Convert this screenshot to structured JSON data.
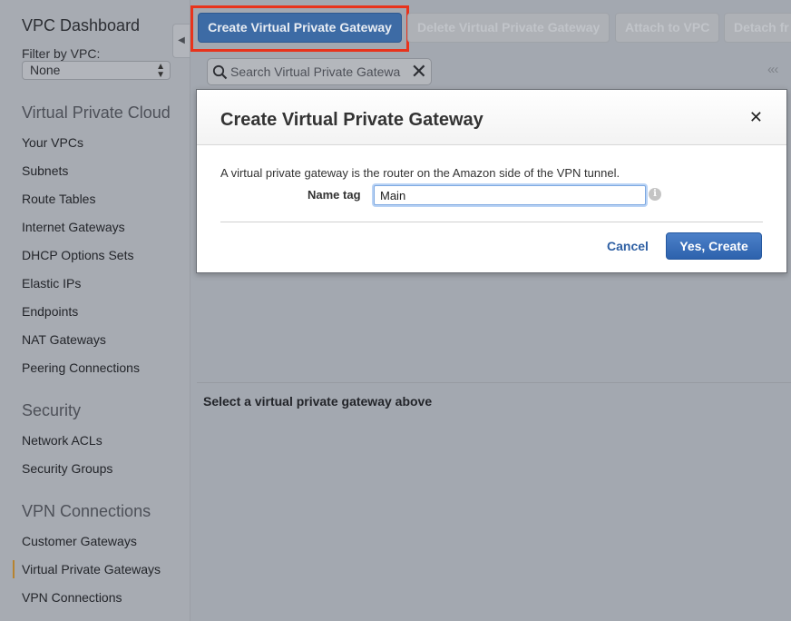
{
  "sidebar": {
    "title": "VPC Dashboard",
    "filter_label": "Filter by VPC:",
    "filter_value": "None",
    "sections": [
      {
        "heading": "Virtual Private Cloud",
        "items": [
          "Your VPCs",
          "Subnets",
          "Route Tables",
          "Internet Gateways",
          "DHCP Options Sets",
          "Elastic IPs",
          "Endpoints",
          "NAT Gateways",
          "Peering Connections"
        ]
      },
      {
        "heading": "Security",
        "items": [
          "Network ACLs",
          "Security Groups"
        ]
      },
      {
        "heading": "VPN Connections",
        "items": [
          "Customer Gateways",
          "Virtual Private Gateways",
          "VPN Connections"
        ]
      }
    ],
    "active_item": "Virtual Private Gateways"
  },
  "toolbar": {
    "create_label": "Create Virtual Private Gateway",
    "delete_label": "Delete Virtual Private Gateway",
    "attach_label": "Attach to VPC",
    "detach_label": "Detach fr"
  },
  "search": {
    "placeholder": "Search Virtual Private Gatewa"
  },
  "content": {
    "prompt": "Select a virtual private gateway above"
  },
  "dialog": {
    "title": "Create Virtual Private Gateway",
    "description": "A virtual private gateway is the router on the Amazon side of the VPN tunnel.",
    "name_label": "Name tag",
    "name_value": "Main",
    "cancel_label": "Cancel",
    "create_label": "Yes, Create"
  },
  "colors": {
    "highlight": "#e8331c",
    "primary_button": "#2d62ad",
    "active_marker": "#b7832f"
  },
  "icons": [
    "collapse-left-icon",
    "search-icon",
    "clear-icon",
    "pager-first-icon",
    "pager-prev-icon",
    "info-icon",
    "close-icon"
  ]
}
